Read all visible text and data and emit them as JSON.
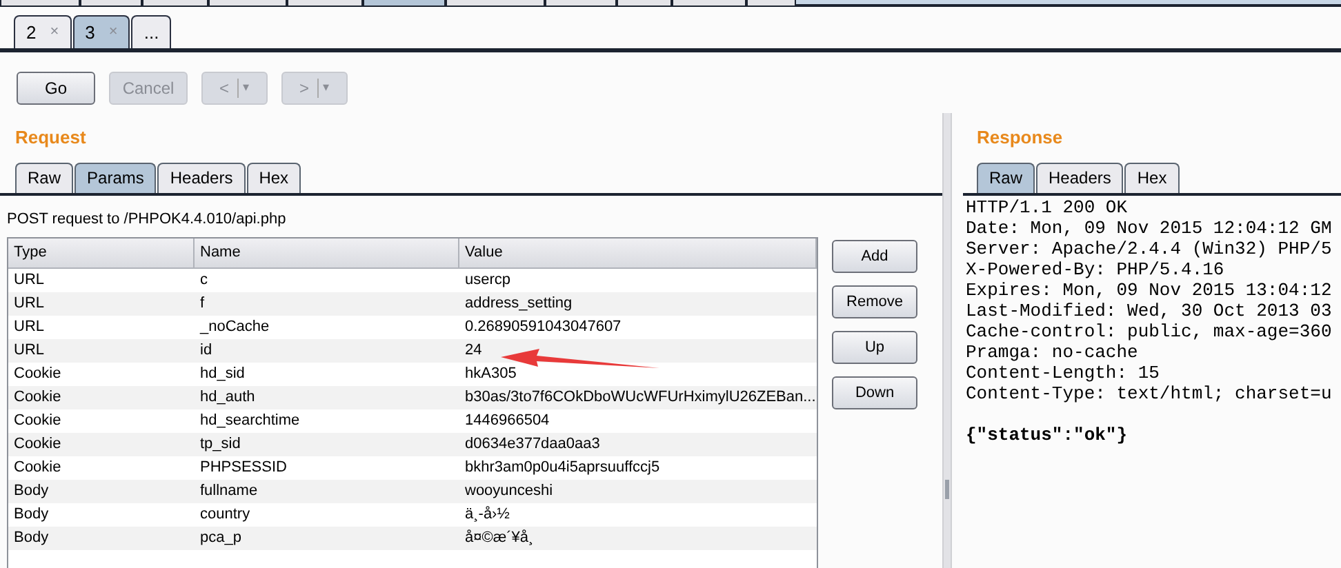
{
  "top_tabs": [
    {
      "selected": false
    },
    {
      "selected": false
    },
    {
      "selected": false
    },
    {
      "selected": false
    },
    {
      "selected": false
    },
    {
      "selected": true
    },
    {
      "selected": false
    },
    {
      "selected": false
    },
    {
      "selected": false
    },
    {
      "selected": false
    },
    {
      "selected": false
    }
  ],
  "repeater_tabs": [
    {
      "label": "2",
      "close": "×",
      "selected": false
    },
    {
      "label": "3",
      "close": "×",
      "selected": true
    },
    {
      "label": "...",
      "selected": false
    }
  ],
  "toolbar": {
    "go": {
      "label": "Go",
      "disabled": false
    },
    "cancel": {
      "label": "Cancel",
      "disabled": true
    },
    "back": {
      "label": "<",
      "menu": "▾",
      "disabled": true
    },
    "forward": {
      "label": ">",
      "menu": "▾",
      "disabled": true
    }
  },
  "request": {
    "title": "Request",
    "tabs": [
      {
        "label": "Raw",
        "selected": false
      },
      {
        "label": "Params",
        "selected": true
      },
      {
        "label": "Headers",
        "selected": false
      },
      {
        "label": "Hex",
        "selected": false
      }
    ],
    "summary": "POST request to /PHPOK4.4.010/api.php",
    "table": {
      "columns": [
        "Type",
        "Name",
        "Value"
      ],
      "rows": [
        [
          "URL",
          "c",
          "usercp"
        ],
        [
          "URL",
          "f",
          "address_setting"
        ],
        [
          "URL",
          "_noCache",
          "0.26890591043047607"
        ],
        [
          "URL",
          "id",
          "24"
        ],
        [
          "Cookie",
          "hd_sid",
          "hkA305"
        ],
        [
          "Cookie",
          "hd_auth",
          "b30as/3to7f6COkDboWUcWFUrHximylU26ZEBan..."
        ],
        [
          "Cookie",
          "hd_searchtime",
          "1446966504"
        ],
        [
          "Cookie",
          "tp_sid",
          "d0634e377daa0aa3"
        ],
        [
          "Cookie",
          "PHPSESSID",
          "bkhr3am0p0u4i5aprsuuffccj5"
        ],
        [
          "Body",
          "fullname",
          "wooyunceshi"
        ],
        [
          "Body",
          "country",
          "ä¸-å›½"
        ],
        [
          "Body",
          "pca_p",
          "å¤©æ´¥å¸"
        ]
      ]
    },
    "buttons": [
      "Add",
      "Remove",
      "Up",
      "Down"
    ]
  },
  "response": {
    "title": "Response",
    "tabs": [
      {
        "label": "Raw",
        "selected": true
      },
      {
        "label": "Headers",
        "selected": false
      },
      {
        "label": "Hex",
        "selected": false
      }
    ],
    "headers": [
      "HTTP/1.1 200 OK",
      "Date: Mon, 09 Nov 2015 12:04:12 GM",
      "Server: Apache/2.4.4 (Win32) PHP/5",
      "X-Powered-By: PHP/5.4.16",
      "Expires: Mon, 09 Nov 2015 13:04:12",
      "Last-Modified: Wed, 30 Oct 2013 03",
      "Cache-control: public, max-age=360",
      "Pramga: no-cache",
      "Content-Length: 15",
      "Content-Type: text/html; charset=u"
    ],
    "body": "{\"status\":\"ok\"}"
  }
}
